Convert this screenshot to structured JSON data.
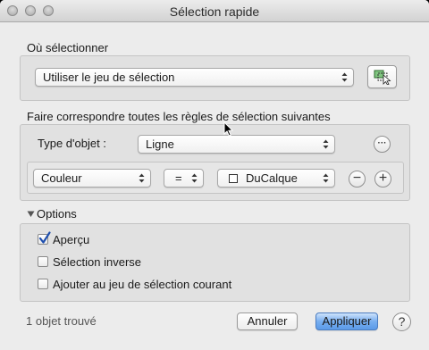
{
  "window": {
    "title": "Sélection rapide"
  },
  "where": {
    "label": "Où sélectionner",
    "dropdown_value": "Utiliser le jeu de sélection"
  },
  "rules": {
    "label": "Faire correspondre toutes les règles de sélection suivantes",
    "object_type_label": "Type d'objet :",
    "object_type_value": "Ligne",
    "more_button": "···",
    "property_value": "Couleur",
    "operator_value": "=",
    "color_value": "DuCalque",
    "remove_button": "−",
    "add_button": "+"
  },
  "options": {
    "label": "Options",
    "preview_label": "Aperçu",
    "preview_checked": true,
    "invert_label": "Sélection inverse",
    "invert_checked": false,
    "append_label": "Ajouter au jeu de sélection courant",
    "append_checked": false
  },
  "footer": {
    "status": "1 objet trouvé",
    "cancel_label": "Annuler",
    "apply_label": "Appliquer",
    "help_label": "?"
  },
  "colors": {
    "accent": "#5b9be8",
    "checkmark": "#1f4fae"
  }
}
